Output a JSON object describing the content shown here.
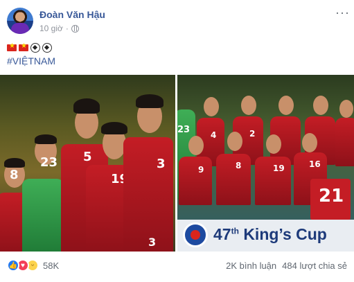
{
  "post": {
    "author": "Đoàn Văn Hậu",
    "time": "10 giờ",
    "privacy_icon": "globe-icon",
    "more_icon": "more-options-icon",
    "more_label": "···",
    "emojis": [
      "vn-flag-icon",
      "vn-flag-icon",
      "soccer-ball-icon",
      "soccer-ball-icon"
    ],
    "hashtag": "#VIỆTNAM"
  },
  "photos": {
    "left": {
      "numbers": [
        "8",
        "23",
        "5",
        "19",
        "3",
        "3"
      ]
    },
    "right": {
      "numbers": [
        "23",
        "4",
        "2",
        "9",
        "8",
        "19",
        "16",
        "21"
      ],
      "banner_text": "47",
      "banner_sup": "th",
      "banner_title": "King’s Cup"
    }
  },
  "footer": {
    "reaction_icons": [
      "like-icon",
      "love-icon",
      "haha-icon"
    ],
    "reaction_count": "58K",
    "comments": "2K bình luận",
    "shares": "484 lượt chia sẻ"
  },
  "colors": {
    "link": "#385898",
    "muted": "#90949c",
    "jersey_red": "#c41d25",
    "like": "#2078f4",
    "love": "#f33e58",
    "haha": "#fcd34d"
  }
}
